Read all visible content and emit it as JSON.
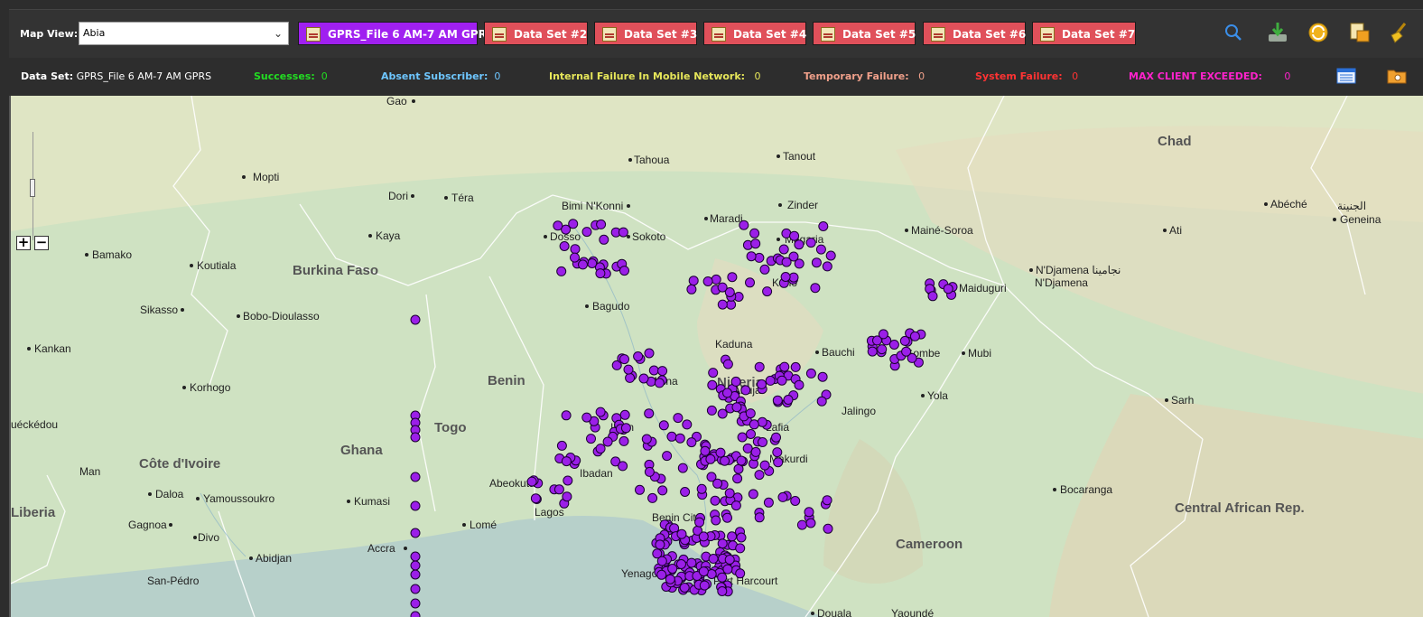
{
  "toolbar": {
    "map_view_label": "Map View:",
    "map_view_value": "Abia",
    "datasets": [
      {
        "label": "GPRS_File 6 AM-7 AM GPRS",
        "active": true
      },
      {
        "label": "Data Set #2",
        "active": false
      },
      {
        "label": "Data Set #3",
        "active": false
      },
      {
        "label": "Data Set #4",
        "active": false
      },
      {
        "label": "Data Set #5",
        "active": false
      },
      {
        "label": "Data Set #6",
        "active": false
      },
      {
        "label": "Data Set #7",
        "active": false
      }
    ],
    "tools": [
      "search-icon",
      "download-icon",
      "refresh-icon",
      "export-icon",
      "clear-icon"
    ]
  },
  "status": {
    "dataset_label": "Data Set:",
    "dataset_value": "GPRS_File 6 AM-7 AM GPRS",
    "successes_label": "Successes:",
    "successes_value": "0",
    "absent_label": "Absent Subscriber:",
    "absent_value": "0",
    "internal_label": "Internal Failure In Mobile Network:",
    "internal_value": "0",
    "temporary_label": "Temporary Failure:",
    "temporary_value": "0",
    "system_label": "System Failure:",
    "system_value": "0",
    "maxclient_label": "MAX CLIENT EXCEEDED:",
    "maxclient_value": "0",
    "colors": {
      "successes": "#22dd22",
      "absent": "#6ec6ff",
      "internal": "#e6e65a",
      "temporary": "#f0a08a",
      "system": "#ff3333",
      "maxclient": "#ff22cc"
    }
  },
  "map": {
    "countries": [
      "Chad",
      "Burkina Faso",
      "Benin",
      "Nigeria",
      "Togo",
      "Ghana",
      "Côte d'Ivoire",
      "Liberia",
      "Cameroon",
      "Central African Rep."
    ],
    "cities": [
      "Gao",
      "Tahoua",
      "Tanout",
      "Mopti",
      "Dori",
      "Téra",
      "Bimi N'Konni",
      "Maradi",
      "Zinder",
      "Abéché",
      "الجنينة",
      "Geneina",
      "Bamako",
      "Kaya",
      "Dosso",
      "Sokoto",
      "Magaria",
      "Mainé-Soroa",
      "Ati",
      "Koutiala",
      "N'Djamena نجامينا",
      "N'Djamena",
      "Kano",
      "Maiduguri",
      "Sikasso",
      "Bobo-Dioulasso",
      "Bagudo",
      "Kankan",
      "Kaduna",
      "Bauchi",
      "Gombe",
      "Mubi",
      "Korhogo",
      "Minna",
      "Abuja",
      "Yola",
      "Sarh",
      "uéckédou",
      "Jalingo",
      "Ilorin",
      "Lafia",
      "Man",
      "Makurdi",
      "Ibadan",
      "Abeokuta",
      "Bocaranga",
      "Daloa",
      "Yamoussoukro",
      "Kumasi",
      "Gagnoa",
      "Lomé",
      "Lagos",
      "Benin City",
      "Divo",
      "Accra",
      "Abidjan",
      "Yenagoa",
      "Port Harcourt",
      "San-Pédro",
      "Douala",
      "Yaoundé"
    ],
    "marker_color": "#9b1fe8",
    "marker_count": 430
  }
}
